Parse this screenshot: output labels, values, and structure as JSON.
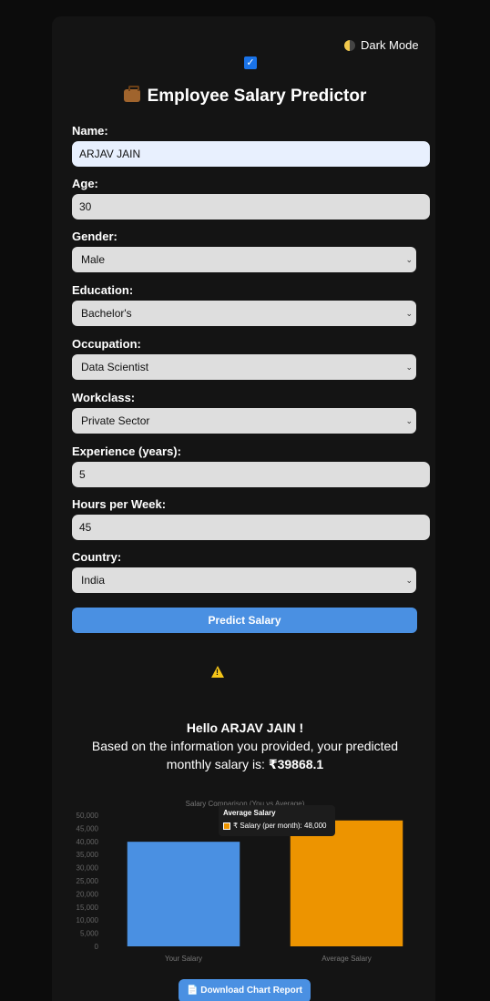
{
  "header": {
    "dark_mode_label": "Dark Mode",
    "dark_mode_checked": true,
    "title": "Employee Salary Predictor",
    "title_icon": "briefcase-icon"
  },
  "form": {
    "name_label": "Name:",
    "name_value": "ARJAV JAIN",
    "age_label": "Age:",
    "age_value": "30",
    "gender_label": "Gender:",
    "gender_value": "Male",
    "education_label": "Education:",
    "education_value": "Bachelor's",
    "occupation_label": "Occupation:",
    "occupation_value": "Data Scientist",
    "workclass_label": "Workclass:",
    "workclass_value": "Private Sector",
    "experience_label": "Experience (years):",
    "experience_value": "5",
    "hours_label": "Hours per Week:",
    "hours_value": "45",
    "country_label": "Country:",
    "country_value": "India",
    "predict_label": "Predict Salary"
  },
  "result": {
    "greeting": "Hello ARJAV JAIN !",
    "message": "Based on the information you provided, your predicted monthly salary is:",
    "salary": "₹39868.1"
  },
  "chart_data": {
    "type": "bar",
    "title": "Salary Comparison (You vs Average)",
    "categories": [
      "Your Salary",
      "Average Salary"
    ],
    "series": [
      {
        "name": "₹ Salary (per month)",
        "values": [
          39868.1,
          48000
        ]
      }
    ],
    "colors": [
      "#4a90e2",
      "#ed9400"
    ],
    "ylim": [
      0,
      50000
    ],
    "yticks": [
      "0",
      "5,000",
      "10,000",
      "15,000",
      "20,000",
      "25,000",
      "30,000",
      "35,000",
      "40,000",
      "45,000",
      "50,000"
    ],
    "tooltip": {
      "title": "Average Salary",
      "text": "₹ Salary (per month): 48,000"
    }
  },
  "download_label": "Download Chart Report"
}
